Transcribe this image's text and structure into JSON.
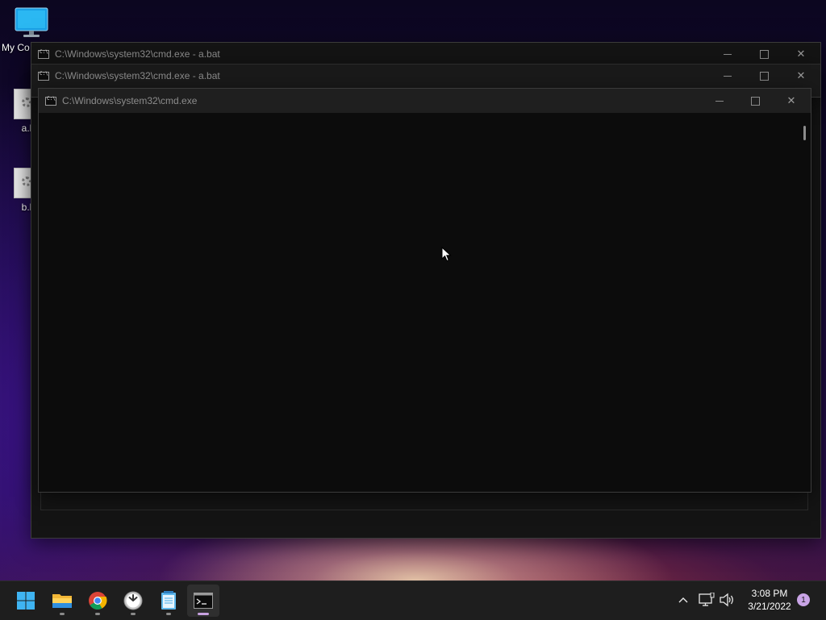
{
  "desktop": {
    "icons": [
      {
        "label": "My Co"
      },
      {
        "label": "a.l"
      },
      {
        "label": "b.l"
      }
    ]
  },
  "windows": [
    {
      "title": "C:\\Windows\\system32\\cmd.exe - a.bat"
    },
    {
      "title": "C:\\Windows\\system32\\cmd.exe - a.bat"
    },
    {
      "title": "C:\\Windows\\system32\\cmd.exe"
    }
  ],
  "taskbar": {
    "apps": [
      {
        "icon": "windows-start-icon"
      },
      {
        "icon": "file-explorer-icon"
      },
      {
        "icon": "chrome-icon"
      },
      {
        "icon": "clock-app-icon"
      },
      {
        "icon": "notepad-icon"
      },
      {
        "icon": "command-prompt-icon",
        "active": true
      }
    ],
    "tray": {
      "time": "3:08 PM",
      "date": "3/21/2022",
      "notifications": "1"
    }
  },
  "colors": {
    "accent": "#c9a4e6",
    "console_bg": "#0c0c0c",
    "taskbar_bg": "#1e1e1e"
  }
}
